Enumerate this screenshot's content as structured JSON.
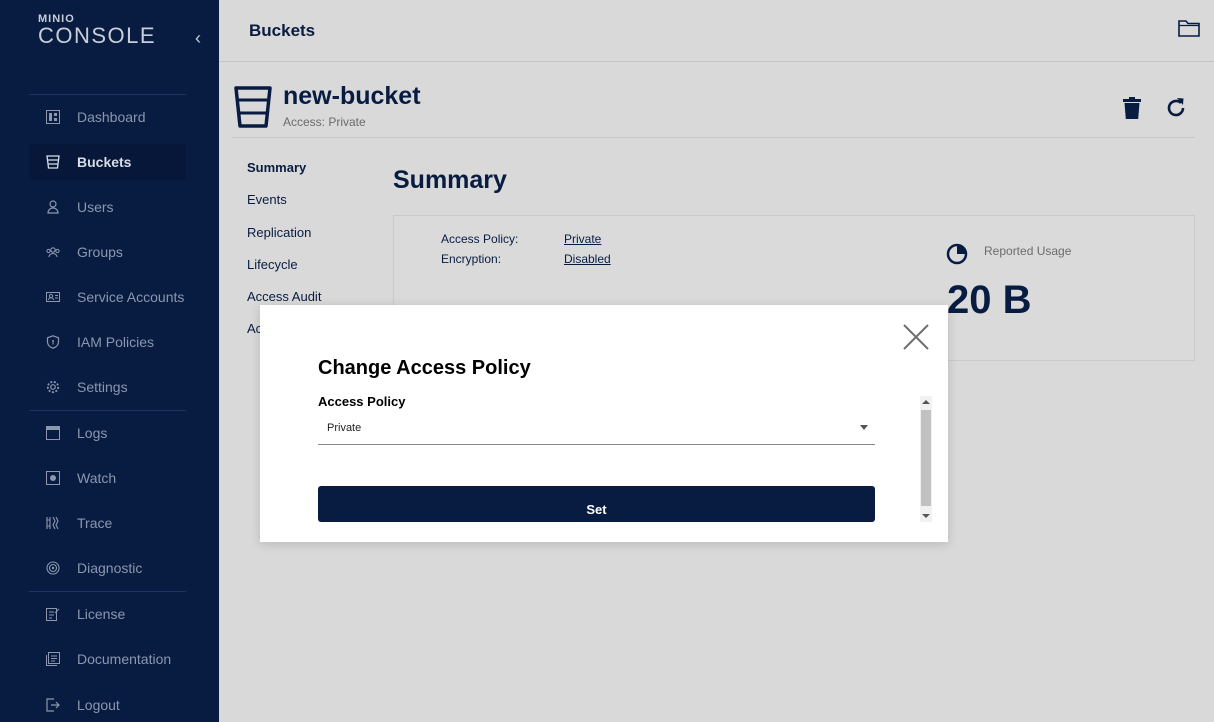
{
  "sidebar": {
    "logo_top": "MINIO",
    "logo_bottom": "CONSOLE",
    "items": [
      {
        "label": "Dashboard",
        "icon": "dashboard-icon"
      },
      {
        "label": "Buckets",
        "icon": "bucket-icon"
      },
      {
        "label": "Users",
        "icon": "user-icon"
      },
      {
        "label": "Groups",
        "icon": "groups-icon"
      },
      {
        "label": "Service Accounts",
        "icon": "service-accounts-icon"
      },
      {
        "label": "IAM Policies",
        "icon": "shield-icon"
      },
      {
        "label": "Settings",
        "icon": "gear-icon"
      },
      {
        "label": "Logs",
        "icon": "logs-icon"
      },
      {
        "label": "Watch",
        "icon": "watch-icon"
      },
      {
        "label": "Trace",
        "icon": "trace-icon"
      },
      {
        "label": "Diagnostic",
        "icon": "diagnostic-icon"
      },
      {
        "label": "License",
        "icon": "license-icon"
      },
      {
        "label": "Documentation",
        "icon": "documentation-icon"
      },
      {
        "label": "Logout",
        "icon": "logout-icon"
      }
    ],
    "active": "Buckets"
  },
  "header": {
    "title": "Buckets"
  },
  "bucket": {
    "name": "new-bucket",
    "access": "Access: Private"
  },
  "subnav": [
    "Summary",
    "Events",
    "Replication",
    "Lifecycle",
    "Access Audit",
    "Ac"
  ],
  "summary": {
    "title": "Summary",
    "access_policy_label": "Access Policy:",
    "access_policy_value": "Private",
    "encryption_label": "Encryption:",
    "encryption_value": "Disabled",
    "usage_label": "Reported Usage",
    "usage_value": "20 B"
  },
  "modal": {
    "title": "Change Access Policy",
    "field_label": "Access Policy",
    "selected": "Private",
    "button": "Set"
  },
  "colors": {
    "navy": "#081c42",
    "sidebar": "#081c42"
  }
}
